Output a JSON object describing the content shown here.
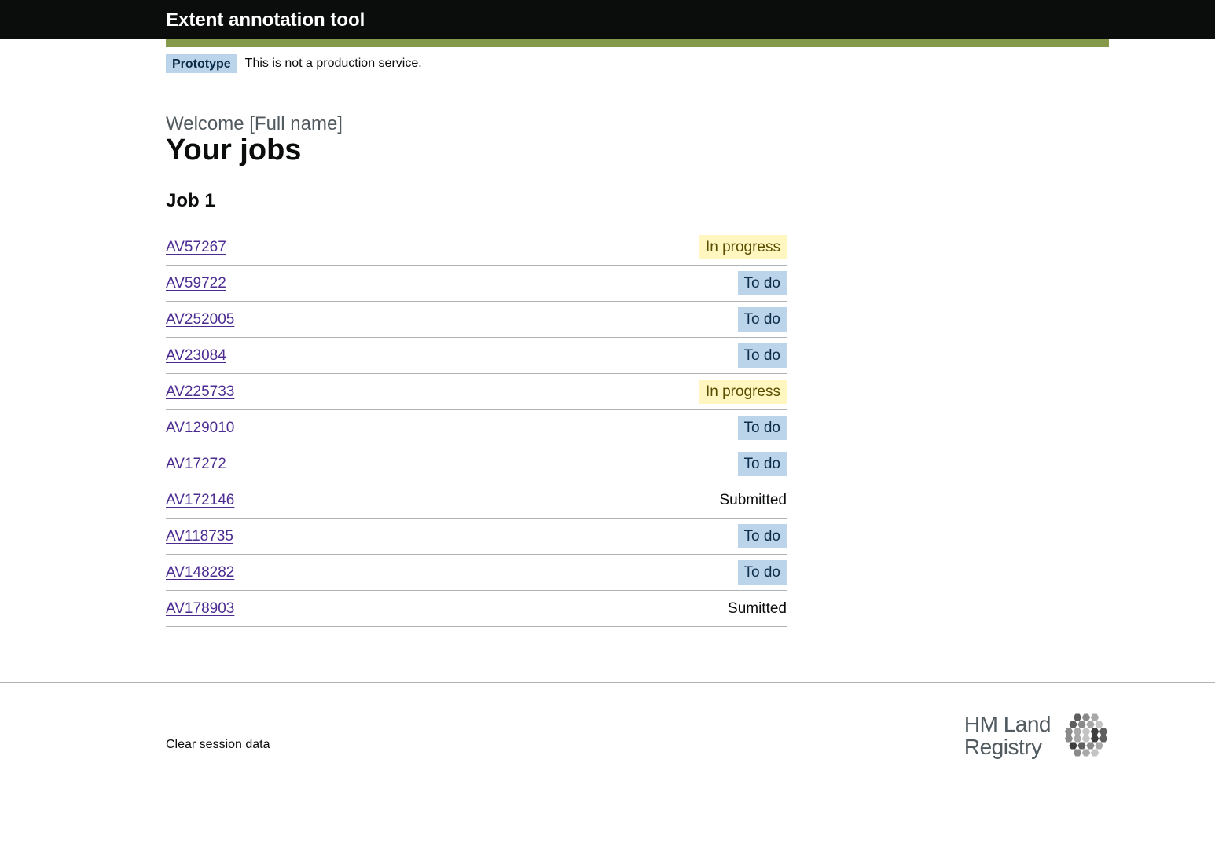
{
  "header": {
    "service_name": "Extent annotation tool"
  },
  "phase_banner": {
    "tag": "Prototype",
    "text": "This is not a production service."
  },
  "page": {
    "caption": "Welcome [Full name]",
    "title": "Your jobs"
  },
  "job": {
    "heading": "Job 1",
    "items": [
      {
        "id": "AV57267",
        "status": "In progress"
      },
      {
        "id": "AV59722",
        "status": "To do"
      },
      {
        "id": "AV252005",
        "status": "To do"
      },
      {
        "id": "AV23084",
        "status": "To do"
      },
      {
        "id": "AV225733",
        "status": "In progress"
      },
      {
        "id": "AV129010",
        "status": "To do"
      },
      {
        "id": "AV17272",
        "status": "To do"
      },
      {
        "id": "AV172146",
        "status": "Submitted"
      },
      {
        "id": "AV118735",
        "status": "To do"
      },
      {
        "id": "AV148282",
        "status": "To do"
      },
      {
        "id": "AV178903",
        "status": "Sumitted"
      }
    ]
  },
  "footer": {
    "clear_session": "Clear session data",
    "logo_line1": "HM Land",
    "logo_line2": "Registry",
    "logo_icon": "hexagon-cluster-icon"
  },
  "colors": {
    "header_bg": "#0b0c0c",
    "stripe": "#85994b",
    "link": "#4c2c92",
    "tag_todo": "#bbd4ea",
    "tag_progress": "#fff7bf"
  }
}
